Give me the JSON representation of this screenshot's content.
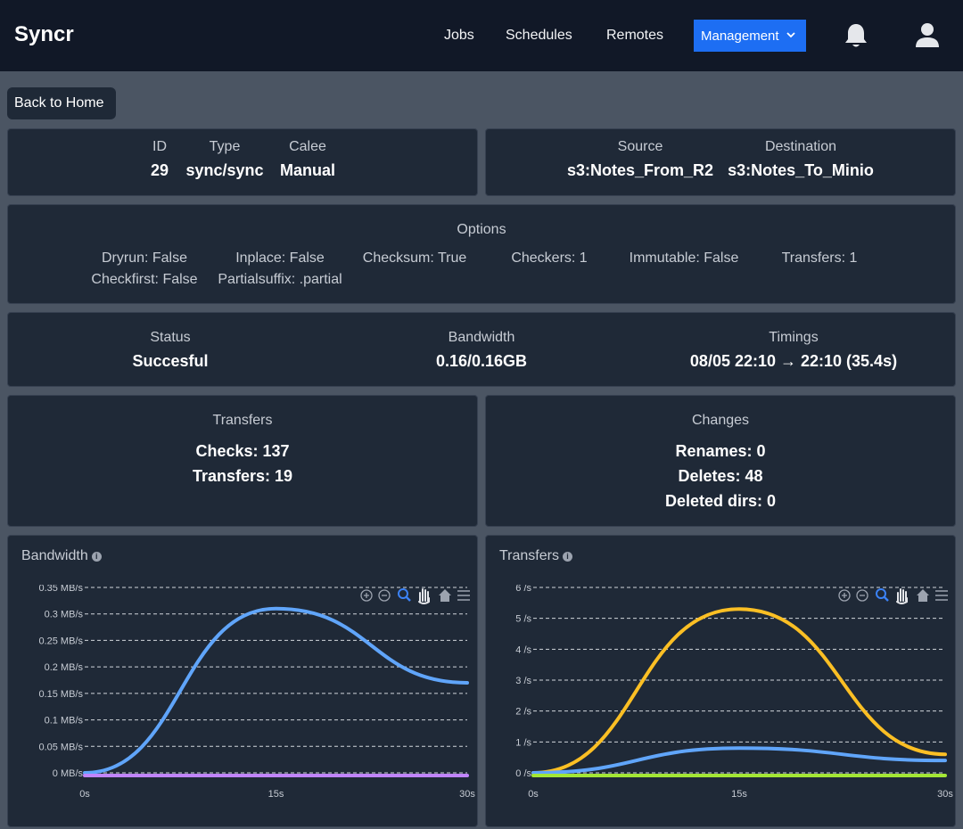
{
  "nav": {
    "brand": "Syncr",
    "links": [
      "Jobs",
      "Schedules",
      "Remotes"
    ],
    "management_label": "Management"
  },
  "back_label": "Back to Home",
  "job": {
    "id_label": "ID",
    "id": "29",
    "type_label": "Type",
    "type": "sync/sync",
    "calee_label": "Calee",
    "calee": "Manual"
  },
  "route": {
    "source_label": "Source",
    "source": "s3:Notes_From_R2",
    "destination_label": "Destination",
    "destination": "s3:Notes_To_Minio"
  },
  "options": {
    "title": "Options",
    "items": [
      "Dryrun: False",
      "Inplace: False",
      "Checksum: True",
      "Checkers: 1",
      "Immutable: False",
      "Transfers: 1",
      "Checkfirst: False",
      "Partialsuffix: .partial"
    ]
  },
  "summary": {
    "status_label": "Status",
    "status": "Succesful",
    "bandwidth_label": "Bandwidth",
    "bandwidth": "0.16/0.16GB",
    "timings_label": "Timings",
    "timings": "08/05 22:10 → 22:10 (35.4s)"
  },
  "transfers": {
    "title": "Transfers",
    "checks": "Checks: 137",
    "transfers": "Transfers: 19"
  },
  "changes": {
    "title": "Changes",
    "renames": "Renames: 0",
    "deletes": "Deletes: 48",
    "deleted_dirs": "Deleted dirs: 0"
  },
  "chart_data": [
    {
      "type": "area",
      "title": "Bandwidth",
      "x": [
        0,
        15,
        30
      ],
      "x_ticks": [
        "0s",
        "15s",
        "30s"
      ],
      "y_ticks": [
        "0 MB/s",
        "0.05 MB/s",
        "0.1 MB/s",
        "0.15 MB/s",
        "0.2 MB/s",
        "0.25 MB/s",
        "0.3 MB/s",
        "0.35 MB/s"
      ],
      "ylim": [
        0,
        0.35
      ],
      "grid": true,
      "series": [
        {
          "color": "#60a5fa",
          "x": [
            0,
            15,
            30
          ],
          "values": [
            0,
            0.31,
            0.17
          ]
        },
        {
          "color": "#c084fc",
          "x": [
            0,
            15,
            30
          ],
          "values": [
            0,
            0,
            0
          ]
        }
      ]
    },
    {
      "type": "area",
      "title": "Transfers",
      "x": [
        0,
        15,
        30
      ],
      "x_ticks": [
        "0s",
        "15s",
        "30s"
      ],
      "y_ticks": [
        "0 /s",
        "1 /s",
        "2 /s",
        "3 /s",
        "4 /s",
        "5 /s",
        "6 /s"
      ],
      "ylim": [
        0,
        6
      ],
      "grid": true,
      "series": [
        {
          "color": "#fbbf24",
          "x": [
            0,
            15,
            30
          ],
          "values": [
            0,
            5.3,
            0.6
          ]
        },
        {
          "color": "#60a5fa",
          "x": [
            0,
            15,
            30
          ],
          "values": [
            0,
            0.8,
            0.4
          ]
        },
        {
          "color": "#a3e635",
          "x": [
            0,
            15,
            30
          ],
          "values": [
            0,
            0,
            0
          ]
        }
      ]
    }
  ]
}
